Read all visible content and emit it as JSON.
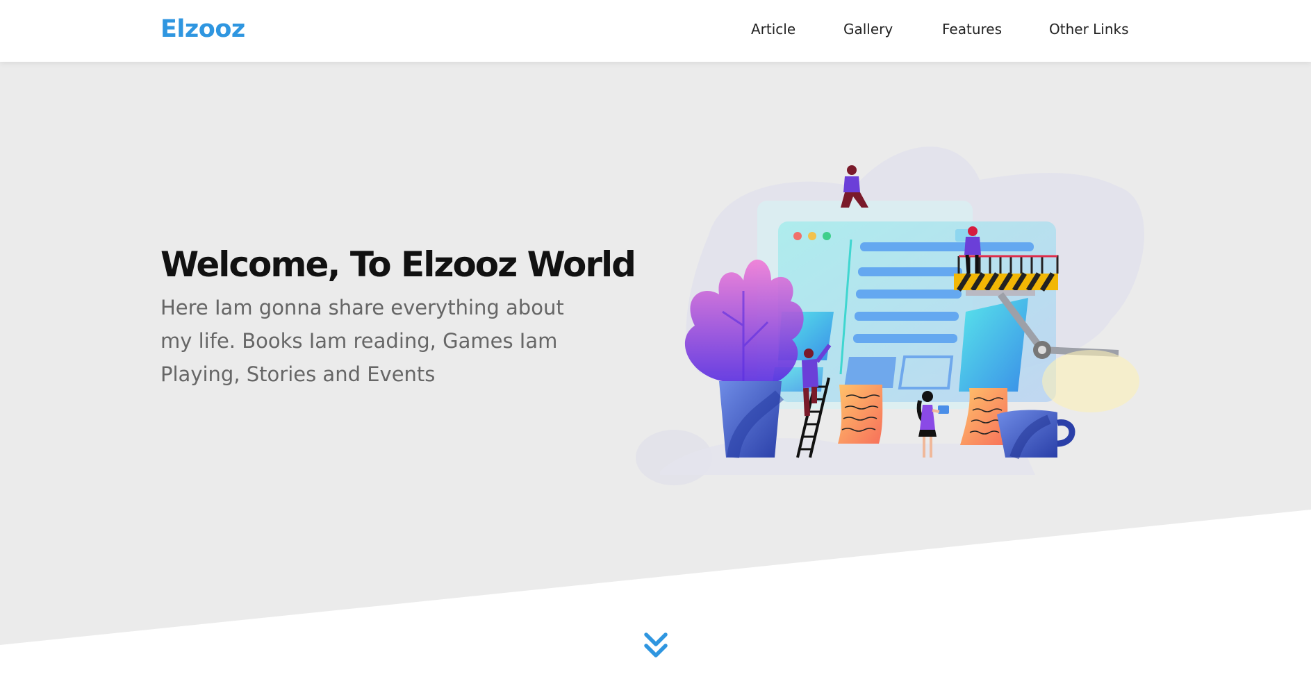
{
  "header": {
    "logo": "Elzooz",
    "nav": [
      {
        "label": "Article"
      },
      {
        "label": "Gallery"
      },
      {
        "label": "Features"
      },
      {
        "label": "Other Links"
      }
    ]
  },
  "hero": {
    "title": "Welcome, To Elzooz World",
    "text": "Here Iam gonna share everything about my life. Books Iam reading, Games Iam Playing, Stories and Events",
    "illustration": "web-building-illustration",
    "scroll_icon": "double-chevron-down-icon"
  },
  "colors": {
    "accent": "#2f96e0",
    "hero_bg": "#ebebeb",
    "title": "#111111",
    "body_text": "#666666"
  }
}
